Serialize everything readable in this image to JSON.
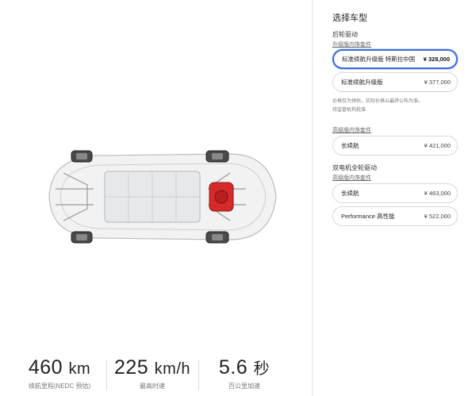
{
  "stats": [
    {
      "value": "460",
      "unit": "km",
      "label": "续航里程(NEDC 预估)"
    },
    {
      "value": "225",
      "unit": "km/h",
      "label": "最高时速"
    },
    {
      "value": "5.6",
      "unit": "秒",
      "label": "百公里加速"
    }
  ],
  "panel": {
    "title": "选择车型",
    "rwd": {
      "heading": "后轮驱动",
      "pkg_label": "升级版内饰套件",
      "options": [
        {
          "name": "标准续航升级版 特斯拉中国",
          "price": "¥ 328,000",
          "selected": true
        },
        {
          "name": "标准续航升级版",
          "price": "¥ 377,000",
          "selected": false
        }
      ],
      "note_line1": "价格仅为预估，实际价格以最终公布为准。",
      "note_line2": "待监管机构批准"
    },
    "premium": {
      "pkg_label": "高级版内饰套件",
      "options": [
        {
          "name": "长续航",
          "price": "¥ 421,000"
        }
      ]
    },
    "awd": {
      "heading": "双电机全轮驱动",
      "pkg_label": "高级版内饰套件",
      "options": [
        {
          "name": "长续航",
          "price": "¥ 463,000"
        },
        {
          "name": "Performance 高性能",
          "price": "¥ 522,000"
        }
      ]
    }
  },
  "colors": {
    "accent": "#3e6ae1",
    "motor": "#d42a2a"
  }
}
